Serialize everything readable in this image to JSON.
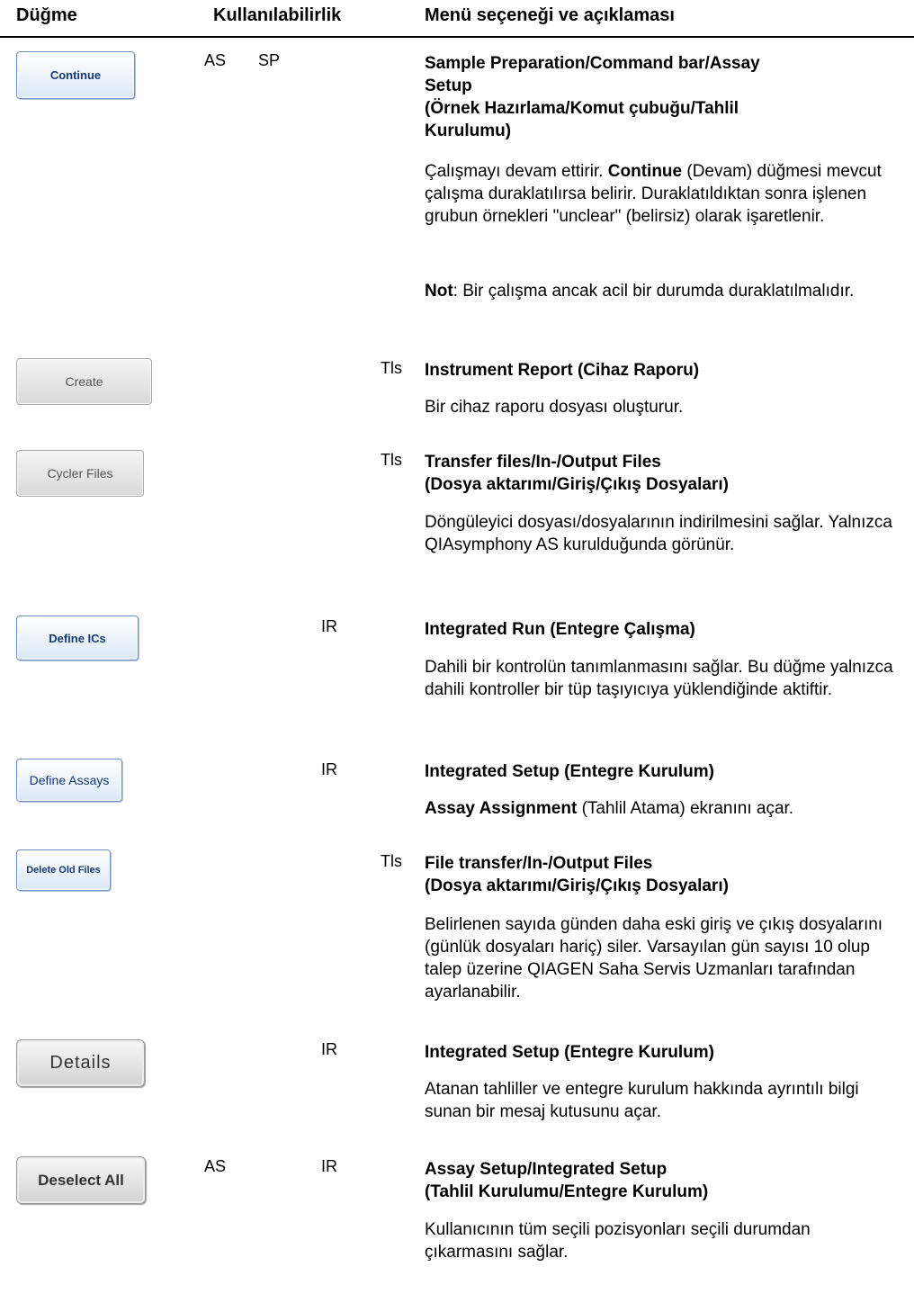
{
  "header": {
    "col_button": "Düğme",
    "col_availability": "Kullanılabilirlik",
    "col_menu": "Menü seçeneği ve açıklaması"
  },
  "rows": [
    {
      "button": "Continue",
      "avail": [
        "AS",
        "SP",
        ""
      ],
      "title_lines": [
        "Sample Preparation/Command bar/Assay",
        "Setup",
        "(Örnek Hazırlama/Komut çubuğu/Tahlil",
        "Kurulumu)"
      ],
      "desc1_pre": "Çalışmayı devam ettirir. ",
      "desc1_bold": "Continue",
      "desc1_post": " (Devam) düğmesi mevcut çalışma duraklatılırsa belirir. Duraklatıldıktan sonra işlenen grubun örnekleri \"unclear\" (belirsiz) olarak işaretlenir.",
      "note_bold": "Not",
      "note_text": ": Bir çalışma ancak acil bir durumda duraklatılmalıdır."
    },
    {
      "button": "Create",
      "avail": [
        "",
        "",
        "Tls"
      ],
      "title_lines": [
        "Instrument Report (Cihaz Raporu)"
      ],
      "desc": "Bir cihaz raporu dosyası oluşturur."
    },
    {
      "button": "Cycler Files",
      "avail": [
        "",
        "",
        "Tls"
      ],
      "title_lines": [
        "Transfer files/In-/Output Files",
        "(Dosya aktarımı/Giriş/Çıkış Dosyaları)"
      ],
      "desc": "Döngüleyici dosyası/dosyalarının indirilmesini sağlar. Yalnızca QIAsymphony AS kurulduğunda görünür."
    },
    {
      "button": "Define ICs",
      "avail": [
        "",
        "IR",
        ""
      ],
      "title_lines": [
        "Integrated Run (Entegre Çalışma)"
      ],
      "desc": "Dahili bir kontrolün tanımlanmasını sağlar. Bu düğme yalnızca dahili kontroller bir tüp taşıyıcıya yüklendiğinde aktiftir."
    },
    {
      "button": "Define Assays",
      "avail": [
        "",
        "IR",
        ""
      ],
      "title_lines": [
        "Integrated Setup (Entegre Kurulum)"
      ],
      "desc_bold": "Assay Assignment",
      "desc_post": " (Tahlil Atama) ekranını açar."
    },
    {
      "button": "Delete Old Files",
      "avail": [
        "",
        "",
        "Tls"
      ],
      "title_lines": [
        "File transfer/In-/Output Files",
        "(Dosya aktarımı/Giriş/Çıkış Dosyaları)"
      ],
      "desc": "Belirlenen sayıda günden daha eski giriş ve çıkış dosyalarını (günlük dosyaları hariç) siler. Varsayılan gün sayısı 10 olup talep üzerine QIAGEN Saha Servis Uzmanları tarafından ayarlanabilir."
    },
    {
      "button": "Details",
      "avail": [
        "",
        "IR",
        ""
      ],
      "title_lines": [
        "Integrated Setup (Entegre Kurulum)"
      ],
      "desc": "Atanan tahliller ve entegre kurulum hakkında ayrıntılı bilgi sunan bir mesaj kutusunu açar."
    },
    {
      "button": "Deselect All",
      "avail": [
        "AS",
        "IR",
        ""
      ],
      "title_lines": [
        "Assay Setup/Integrated Setup",
        "(Tahlil Kurulumu/Entegre Kurulum)"
      ],
      "desc": "Kullanıcının tüm seçili pozisyonları seçili durumdan çıkarmasını sağlar."
    }
  ]
}
